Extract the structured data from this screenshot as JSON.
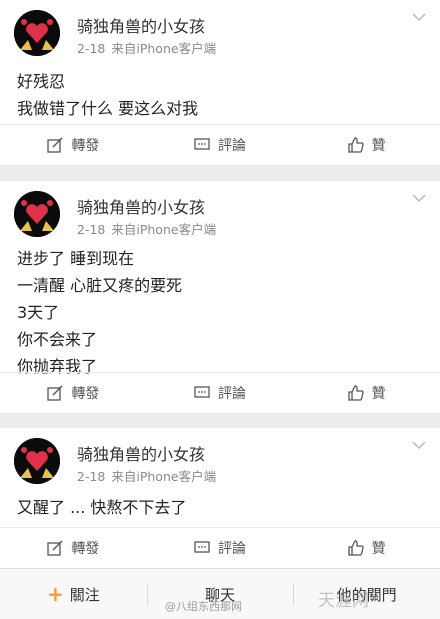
{
  "posts": [
    {
      "username": "骑独角兽的小女孩",
      "date": "2-18",
      "source": "来自iPhone客户端",
      "lines": [
        "好残忍",
        "我做错了什么 要这么对我"
      ],
      "actions": {
        "repost": "轉發",
        "comment": "評論",
        "like": "贊"
      }
    },
    {
      "username": "骑独角兽的小女孩",
      "date": "2-18",
      "source": "来自iPhone客户端",
      "lines": [
        "进步了 睡到现在",
        "一清醒 心脏又疼的要死",
        "3天了",
        "你不会来了",
        "你抛弃我了"
      ],
      "actions": {
        "repost": "轉發",
        "comment": "評論",
        "like": "贊"
      }
    },
    {
      "username": "骑独角兽的小女孩",
      "date": "2-18",
      "source": "来自iPhone客户端",
      "lines": [
        "又醒了 ... 快熬不下去了"
      ],
      "actions": {
        "repost": "轉發",
        "comment": "評論",
        "like": "贊"
      }
    }
  ],
  "bottom_bar": {
    "follow": "關注",
    "chat": "聊天",
    "more": "他的關門"
  },
  "watermark": "@八组东西那网",
  "watermark_corner": "天涯网",
  "colors": {
    "accent": "#f79b2b",
    "avatar_heart": "#e0314b",
    "avatar_figure": "#e8c14a"
  }
}
